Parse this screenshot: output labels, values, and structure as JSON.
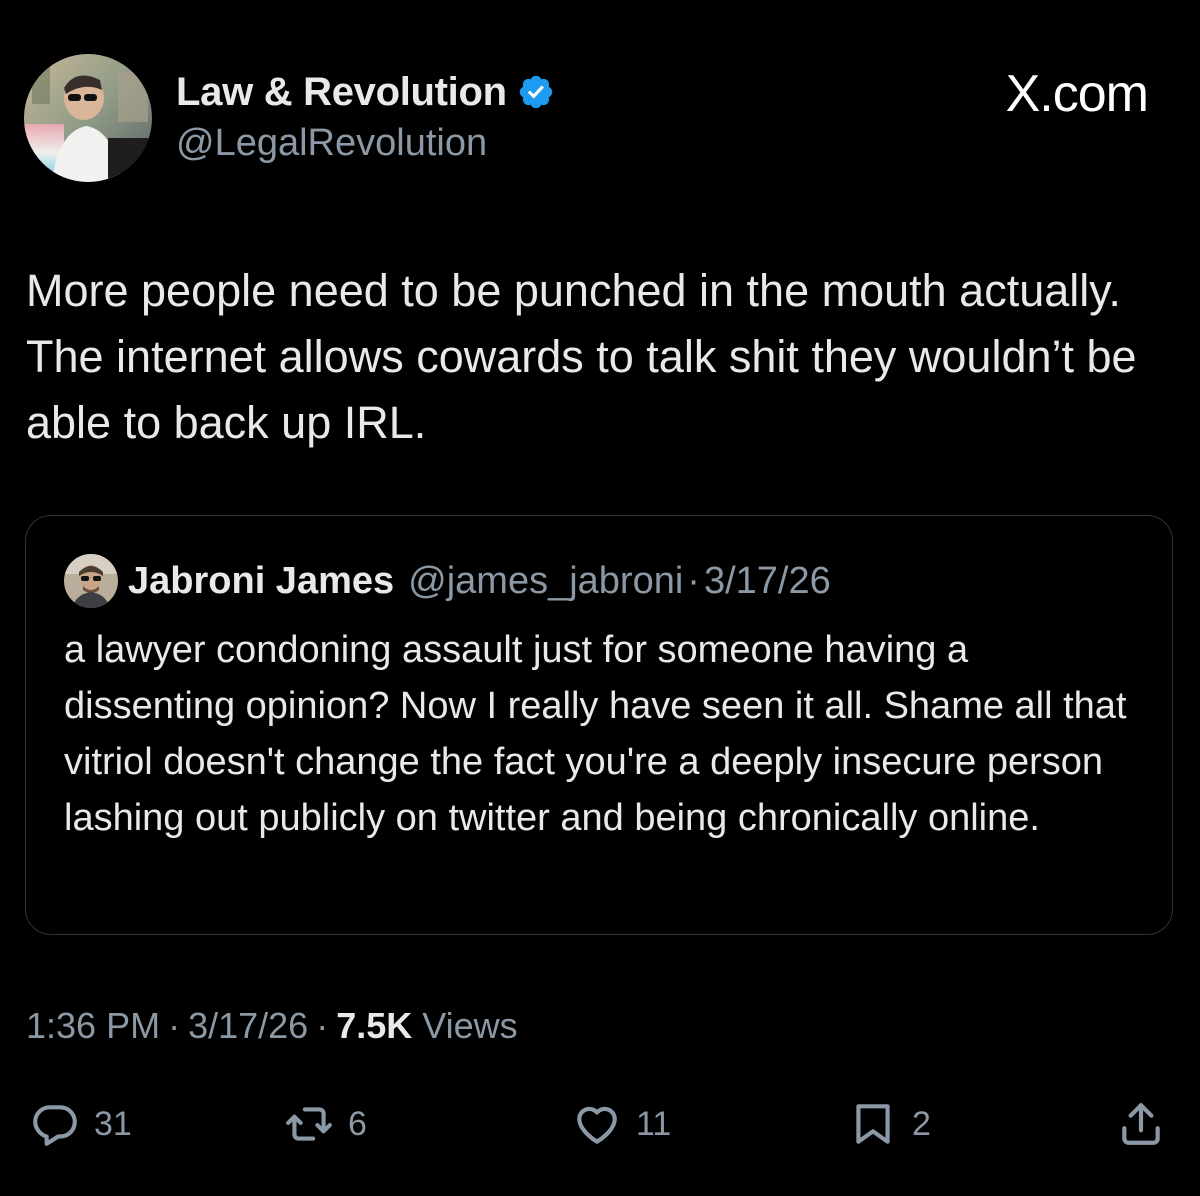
{
  "brand": "X.com",
  "author": {
    "name": "Law & Revolution",
    "handle": "@LegalRevolution",
    "verified": true
  },
  "tweet": {
    "text": "More people need to be punched in the mouth actually. The internet allows cowards to talk shit they wouldn’t be able to back up IRL."
  },
  "quote": {
    "name": "Jabroni James",
    "handle": "@james_jabroni",
    "separator": "·",
    "date": "3/17/26",
    "text": "a lawyer condoning assault just for someone having a dissenting opinion? Now I really have seen it all. Shame all that vitriol doesn't change the fact you're a deeply insecure person lashing out publicly on twitter and being chronically online."
  },
  "meta": {
    "time": "1:36 PM",
    "separator": "·",
    "date": "3/17/26",
    "views_count": "7.5K",
    "views_label": "Views"
  },
  "actions": {
    "replies": "31",
    "reposts": "6",
    "likes": "11",
    "bookmarks": "2"
  },
  "icons": {
    "verified": "verified-badge-icon",
    "reply": "reply-icon",
    "repost": "repost-icon",
    "like": "heart-icon",
    "bookmark": "bookmark-icon",
    "share": "share-icon"
  },
  "colors": {
    "background": "#000000",
    "text_primary": "#e7e9ea",
    "text_secondary": "#8b98a5",
    "border": "#2f3336",
    "verified": "#1d9bf0"
  }
}
